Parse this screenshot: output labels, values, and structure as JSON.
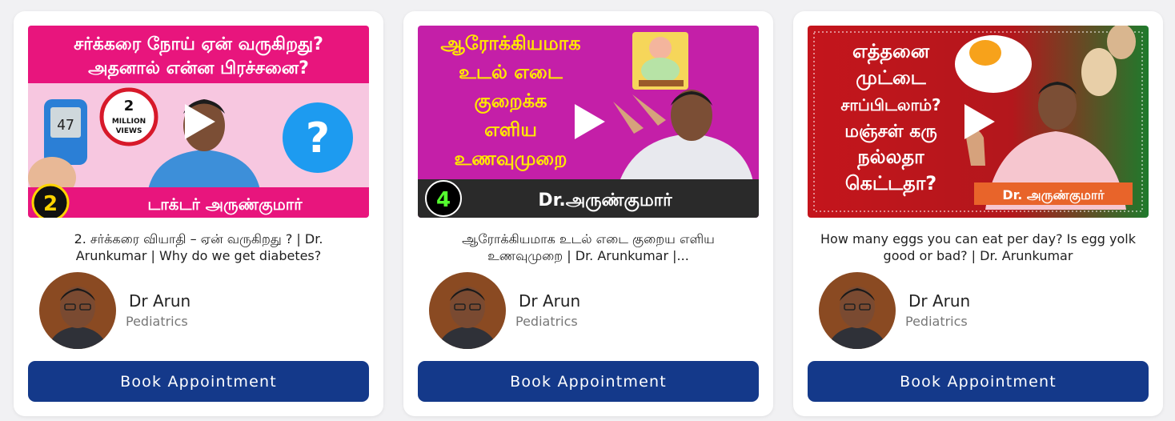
{
  "cards": [
    {
      "title": "2. சர்க்கரை வியாதி – ஏன் வருகிறது ? | Dr. Arunkumar | Why do we get diabetes?",
      "thumbnail": {
        "headline_line1": "சர்க்கரை நோய் ஏன் வருகிறது?",
        "headline_line2": "அதனால் என்ன பிரச்சனை?",
        "badge_number": "2",
        "badge_text_line1": "MILLION",
        "badge_text_line2": "VIEWS",
        "glucometer_reading": "47",
        "episode_number": "2",
        "footer_text": "டாக்டர் அருண்குமார்",
        "question_mark": "?"
      },
      "doctor": {
        "name": "Dr Arun",
        "specialty": "Pediatrics"
      },
      "button_label": "Book Appointment"
    },
    {
      "title": "ஆரோக்கியமாக உடல் எடை குறைய எளிய உணவுமுறை | Dr. Arunkumar |...",
      "thumbnail": {
        "headline_lines": [
          "ஆரோக்கியமாக",
          "உடல் எடை",
          "குறைக்க",
          "எளிய",
          "உணவுமுறை"
        ],
        "episode_number": "4",
        "footer_text": "Dr.அருண்குமார்"
      },
      "doctor": {
        "name": "Dr Arun",
        "specialty": "Pediatrics"
      },
      "button_label": "Book Appointment"
    },
    {
      "title": "How many eggs you can eat per day? Is egg yolk good or bad? | Dr. Arunkumar",
      "thumbnail": {
        "headline_lines": [
          "எத்தனை",
          "முட்டை",
          "சாப்பிடலாம்?",
          "மஞ்சள் கரு",
          "நல்லதா",
          "கெட்டதா?"
        ],
        "footer_text": "Dr. அருண்குமார்"
      },
      "doctor": {
        "name": "Dr Arun",
        "specialty": "Pediatrics"
      },
      "button_label": "Book Appointment"
    }
  ],
  "colors": {
    "button_bg": "#14398a",
    "card_bg": "#ffffff",
    "page_bg": "#f1f1f3",
    "thumb1_banner": "#e8157d",
    "thumb2_bg": "#c41fa8",
    "thumb3_bg": "#c4151c"
  },
  "icons": [
    "play-icon",
    "question-icon",
    "glucometer-icon",
    "avatar-photo"
  ]
}
